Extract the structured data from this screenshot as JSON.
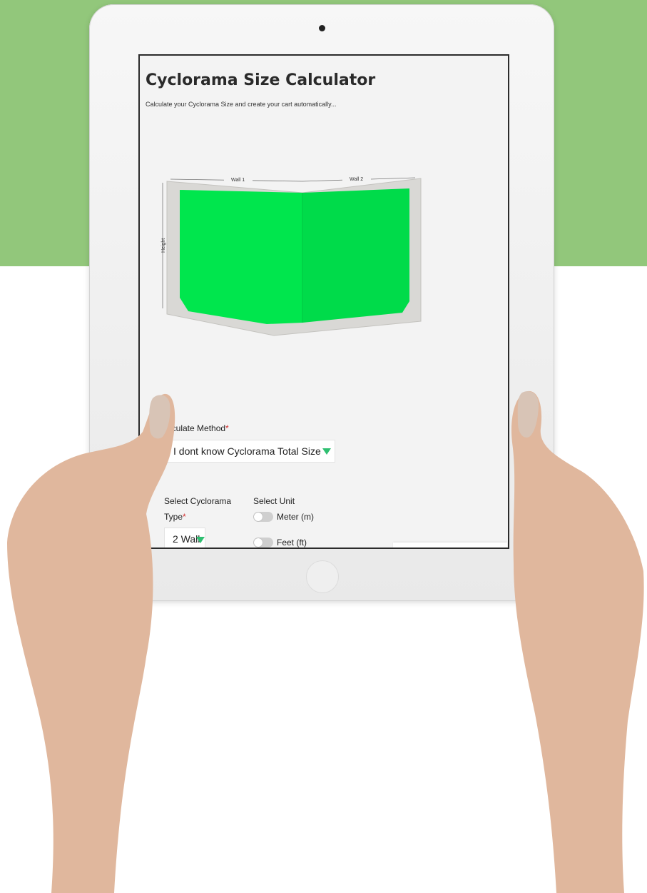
{
  "page": {
    "title": "Cyclorama Size Calculator",
    "subtitle": "Calculate your Cyclorama Size and create your cart automatically..."
  },
  "diagram": {
    "wall1_label": "Wall 1",
    "wall2_label": "Wall 2",
    "height_label": "Height",
    "screen_color": "#00e64d"
  },
  "form": {
    "calculate_method": {
      "label": "lculate Method",
      "required_mark": "*",
      "value": "I dont know Cyclorama Total Size"
    },
    "cyclorama_type": {
      "label_line1": "Select Cyclorama",
      "label_line2": "Type",
      "required_mark": "*",
      "value": "2 Wall"
    },
    "unit": {
      "label": "Select Unit",
      "options": [
        {
          "label": "Meter (m)",
          "selected": false
        },
        {
          "label": "Feet (ft)",
          "selected": false
        }
      ]
    }
  },
  "colors": {
    "background_band": "#92c77b",
    "accent": "#2fbf71"
  },
  "icons": [
    "dropdown-arrow-icon",
    "camera-icon",
    "home-button-icon"
  ]
}
